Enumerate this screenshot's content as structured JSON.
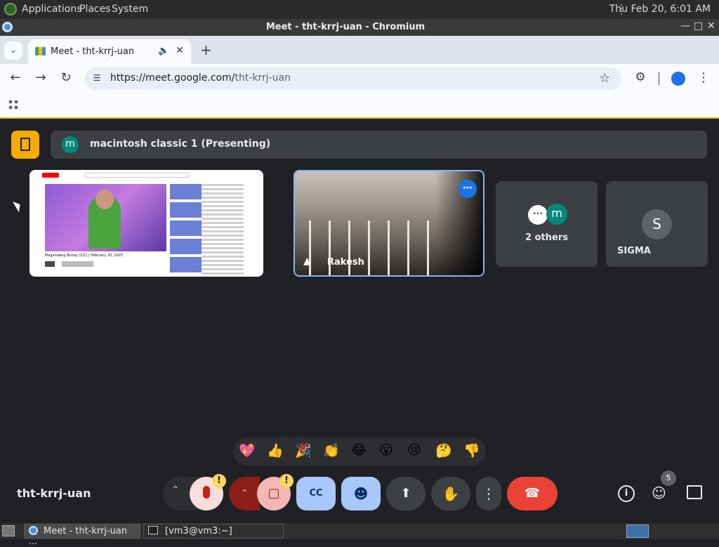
{
  "system_bar": {
    "menus": [
      "Applications",
      "Places",
      "System"
    ],
    "datetime": "Thu Feb 20,  6:01 AM"
  },
  "window": {
    "title": "Meet - tht-krrj-uan - Chromium"
  },
  "browser": {
    "tab_title": "Meet - tht-krrj-uan",
    "url_host": "https://meet.google.com/",
    "url_path": "tht-krrj-uan"
  },
  "meet": {
    "presenter_initial": "m",
    "presenter_label": "macintosh classic 1 (Presenting)",
    "screen_share": {
      "video_title": "Magandang Buhay (1/2) | February 20, 2025"
    },
    "participant_name": "Rakesh",
    "others_label": "2 others",
    "others_initial": "m",
    "sigma_initial": "S",
    "sigma_name": "SIGMA",
    "reactions": [
      "💖",
      "👍",
      "🎉",
      "👏",
      "😂",
      "😮",
      "😢",
      "🤔",
      "👎"
    ],
    "meeting_code": "tht-krrj-uan",
    "people_count": "5",
    "colors": {
      "accent": "#8ab4f8",
      "end_call": "#ea4335",
      "mic_bg": "#f9dedc",
      "cam_bg": "#f2b8b5",
      "cc_bg": "#a8c7fa",
      "warning": "#fdd663",
      "tile_bg": "#3c4043",
      "bg": "#202124"
    }
  },
  "taskbar": {
    "items": [
      "Meet - tht-krrj-uan ...",
      "[vm3@vm3:~]"
    ]
  }
}
